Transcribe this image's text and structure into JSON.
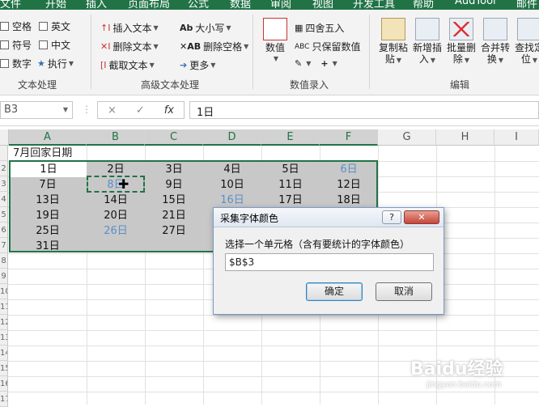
{
  "ribbon_tabs": [
    "文件",
    "开始",
    "插入",
    "页面布局",
    "公式",
    "数据",
    "审阅",
    "视图",
    "开发工具",
    "帮助",
    "AudTool",
    "邮件"
  ],
  "ribbon": {
    "text_processing": {
      "label": "文本处理",
      "items": [
        "空格",
        "英文",
        "符号",
        "中文",
        "数字",
        "执行"
      ]
    },
    "advanced_text": {
      "label": "高级文本处理",
      "items": [
        "插入文本",
        "删除文本",
        "截取文本",
        "大小写",
        "删除空格",
        "更多"
      ]
    },
    "value_entry": {
      "label": "数值录入",
      "numeric": "数值",
      "round": "四舍五入",
      "keep_values": "只保留数值"
    },
    "edit": {
      "label": "编辑",
      "buttons": [
        {
          "line1": "复制粘",
          "line2": "贴"
        },
        {
          "line1": "新增插",
          "line2": "入"
        },
        {
          "line1": "批量删",
          "line2": "除"
        },
        {
          "line1": "合并转",
          "line2": "换"
        },
        {
          "line1": "查找定",
          "line2": "位"
        }
      ]
    }
  },
  "formula_bar": {
    "name_box": "B3",
    "formula": "1日",
    "cancel": "×",
    "confirm": "✓",
    "fx": "fx"
  },
  "sheet": {
    "columns": [
      "A",
      "B",
      "C",
      "D",
      "E",
      "F",
      "G",
      "H",
      "I"
    ],
    "title": "7月回家日期",
    "rows": [
      [
        "1日",
        "2日",
        "3日",
        "4日",
        "5日",
        "6日"
      ],
      [
        "7日",
        "8日",
        "9日",
        "10日",
        "11日",
        "12日"
      ],
      [
        "13日",
        "14日",
        "15日",
        "16日",
        "17日",
        "18日"
      ],
      [
        "19日",
        "20日",
        "21日",
        "",
        "",
        ""
      ],
      [
        "25日",
        "26日",
        "27日",
        "",
        "",
        ""
      ],
      [
        "31日",
        "",
        "",
        "",
        "",
        ""
      ]
    ],
    "row_numbers": [
      "",
      "2",
      "3",
      "4",
      "5",
      "6",
      "7",
      "8",
      "9",
      "10",
      "11",
      "12",
      "13",
      "14",
      "15",
      "16",
      "17"
    ]
  },
  "dialog": {
    "title": "采集字体颜色",
    "help": "?",
    "close": "✕",
    "prompt": "选择一个单元格（含有要统计的字体颜色）",
    "input_value": "$B$3",
    "ok": "确定",
    "cancel": "取消"
  },
  "watermark": {
    "brand": "Baidu经验",
    "url": "jingyan.baidu.com"
  },
  "colors": {
    "excel_green": "#217346",
    "blue_text": "#5b8fc7"
  }
}
